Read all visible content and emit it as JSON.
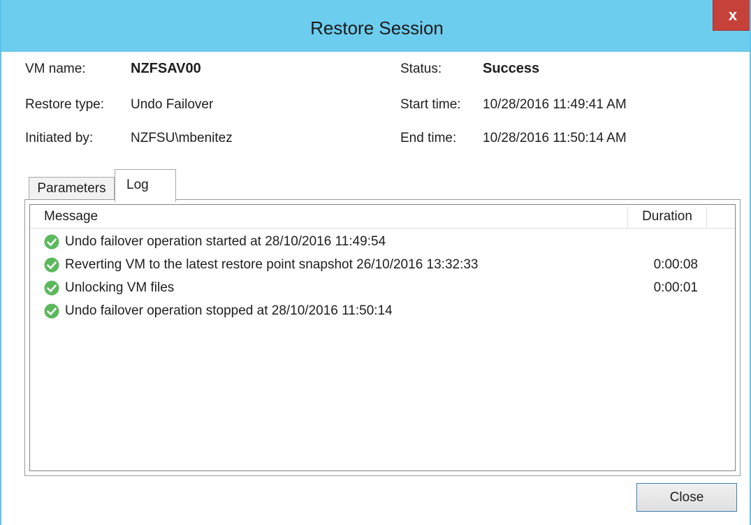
{
  "window": {
    "title": "Restore Session",
    "close_glyph": "x"
  },
  "summary": {
    "vm_name_label": "VM name:",
    "vm_name_value": "NZFSAV00",
    "restore_type_label": "Restore type:",
    "restore_type_value": "Undo Failover",
    "initiated_by_label": "Initiated by:",
    "initiated_by_value": "NZFSU\\mbenitez",
    "status_label": "Status:",
    "status_value": "Success",
    "start_time_label": "Start time:",
    "start_time_value": "10/28/2016 11:49:41 AM",
    "end_time_label": "End time:",
    "end_time_value": "10/28/2016 11:50:14 AM"
  },
  "tabs": [
    {
      "label": "Parameters",
      "selected": false
    },
    {
      "label": "Log",
      "selected": true
    }
  ],
  "log": {
    "columns": [
      "Message",
      "Duration"
    ],
    "rows": [
      {
        "icon": "success-check-icon",
        "message": "Undo failover operation started at 28/10/2016 11:49:54",
        "duration": ""
      },
      {
        "icon": "success-check-icon",
        "message": "Reverting VM to the latest restore point snapshot 26/10/2016 13:32:33",
        "duration": "0:00:08"
      },
      {
        "icon": "success-check-icon",
        "message": "Unlocking VM files",
        "duration": "0:00:01"
      },
      {
        "icon": "success-check-icon",
        "message": "Undo failover operation stopped at 28/10/2016 11:50:14",
        "duration": ""
      }
    ]
  },
  "footer": {
    "close_label": "Close"
  },
  "colors": {
    "titlebar": "#6ccdee",
    "close_button_red": "#c5413a",
    "success_green": "#5cb85c",
    "button_border": "#3c7fb1"
  }
}
